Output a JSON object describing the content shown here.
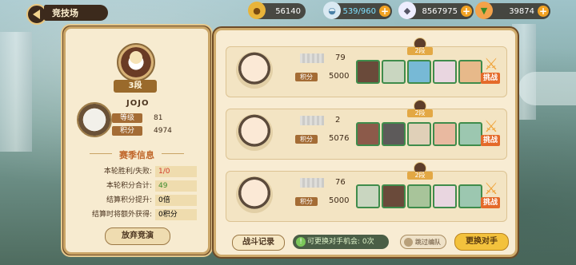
{
  "header": {
    "title": "竞技场",
    "resources": [
      {
        "icon": "coin-icon",
        "value": "56140"
      },
      {
        "icon": "stamina-bowl-icon",
        "value": "539/960"
      },
      {
        "icon": "gem-icon",
        "value": "8567975"
      },
      {
        "icon": "carrot-icon",
        "value": "39874"
      }
    ]
  },
  "player": {
    "rank_label": "3段",
    "name": "JOJO",
    "level_label": "等级",
    "level": "81",
    "score_label": "积分",
    "score": "4974"
  },
  "season": {
    "title": "赛季信息",
    "rows": [
      {
        "label": "本轮胜利/失败:",
        "value": "1/0"
      },
      {
        "label": "本轮积分合计:",
        "value": "49"
      },
      {
        "label": "结算积分提升:",
        "value": "0倍"
      },
      {
        "label": "结算时将额外获得:",
        "value": "0积分"
      }
    ],
    "giveup_label": "放弃竞演"
  },
  "opponents": [
    {
      "number": "79",
      "score_label": "积分",
      "score": "5000",
      "rank": "2段",
      "challenge": "挑战",
      "heroes": [
        "#6a4a3a",
        "#c9d6c0",
        "#77b9d6",
        "#e9d6e0",
        "#e7b98a"
      ]
    },
    {
      "number": "2",
      "score_label": "积分",
      "score": "5076",
      "rank": "2段",
      "challenge": "挑战",
      "heroes": [
        "#8c5a4a",
        "#5d5a5a",
        "#e0d0b8",
        "#e9b9a0",
        "#9cc7b0"
      ]
    },
    {
      "number": "76",
      "score_label": "积分",
      "score": "5000",
      "rank": "2段",
      "challenge": "挑战",
      "heroes": [
        "#c9d6c0",
        "#6a4a3a",
        "#a8c49a",
        "#e9d6e0",
        "#9cc7b0"
      ]
    }
  ],
  "footer": {
    "record_label": "战斗记录",
    "swap_info": "可更换对手机会: 0次",
    "skip_label": "跳过编队",
    "swap_label": "更换对手"
  },
  "colors": {
    "accent": "#a46c35",
    "challenge": "#e46a2a",
    "swap_button": "#f3c23d",
    "hero_border": "#3f8c4b"
  }
}
